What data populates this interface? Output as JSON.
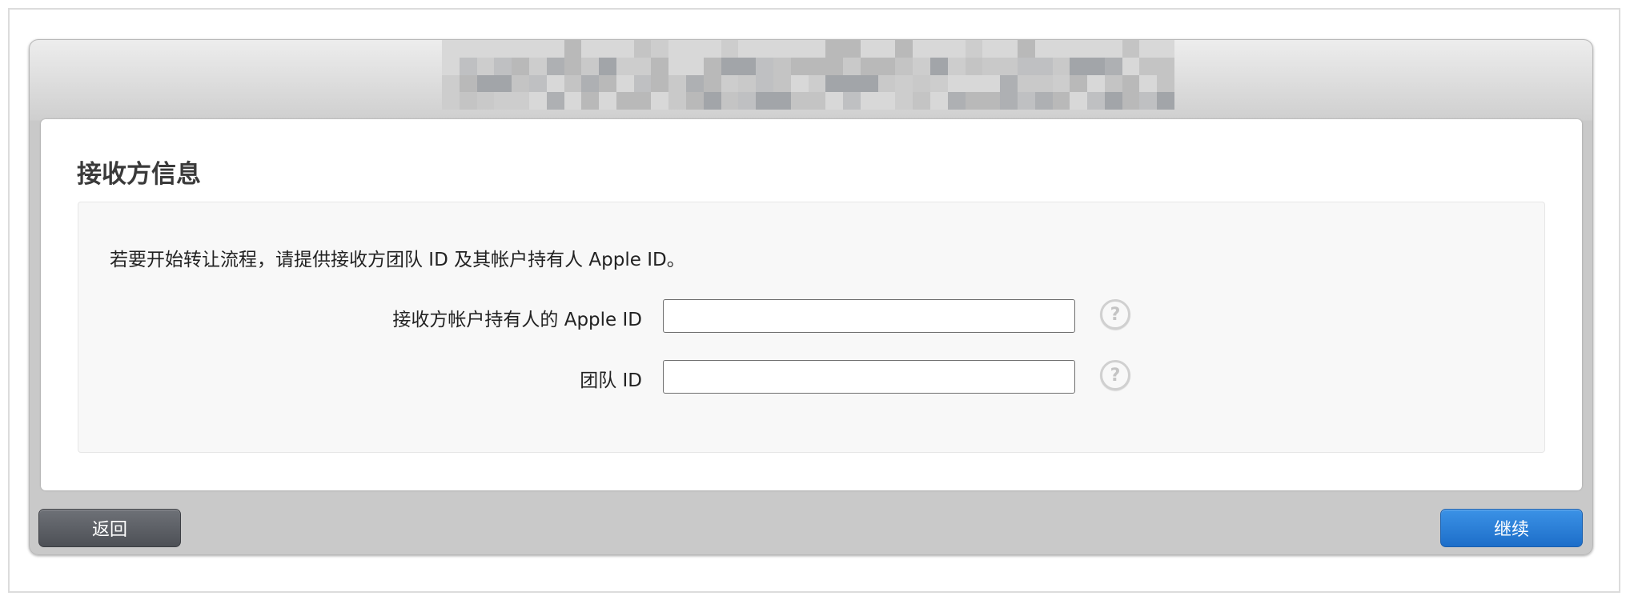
{
  "header": {
    "title_blurred": true
  },
  "section": {
    "title": "接收方信息",
    "intro": "若要开始转让流程，请提供接收方团队 ID 及其帐户持有人 Apple ID。"
  },
  "form": {
    "fields": [
      {
        "label": "接收方帐户持有人的 Apple ID",
        "value": "",
        "help_icon": "question-circle-icon"
      },
      {
        "label": "团队 ID",
        "value": "",
        "help_icon": "question-circle-icon"
      }
    ]
  },
  "footer": {
    "back_label": "返回",
    "continue_label": "继续"
  },
  "colors": {
    "continue_button": "#1d6ec9",
    "back_button": "#4d5056",
    "window_chrome": "#c9c9c9"
  }
}
